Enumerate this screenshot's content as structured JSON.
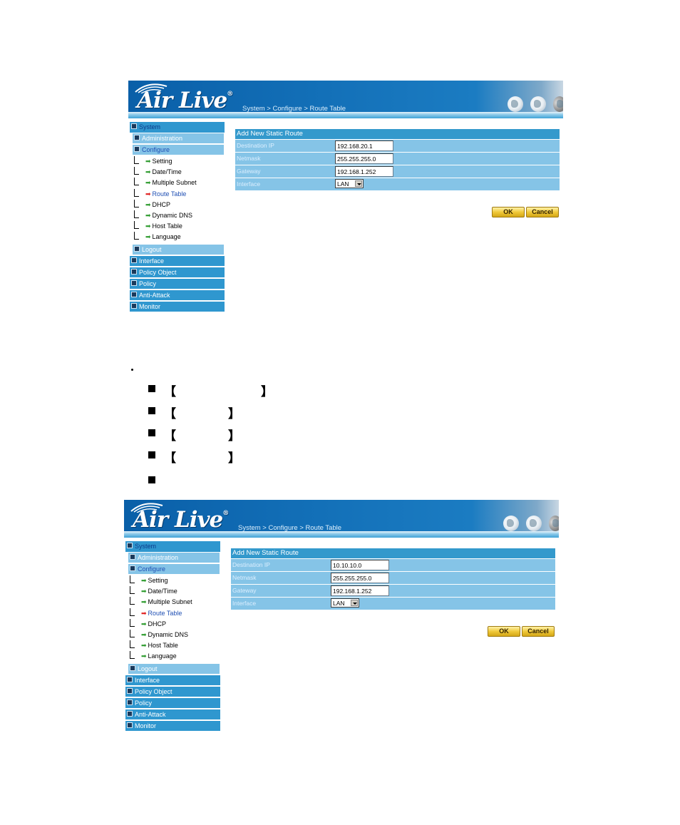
{
  "screenshots": [
    {
      "brand": "Air Live",
      "breadcrumb": "System > Configure > Route Table",
      "sidebar": {
        "system": "System",
        "administration": "Administration",
        "configure": "Configure",
        "items": [
          "Setting",
          "Date/Time",
          "Multiple Subnet",
          "Route Table",
          "DHCP",
          "Dynamic DNS",
          "Host Table",
          "Language"
        ],
        "active_item": "Route Table",
        "logout": "Logout",
        "main": [
          "Interface",
          "Policy Object",
          "Policy",
          "Anti-Attack",
          "Monitor"
        ]
      },
      "form": {
        "title": "Add New Static Route",
        "fields": [
          {
            "label": "Destination IP",
            "value": "192.168.20.1"
          },
          {
            "label": "Netmask",
            "value": "255.255.255.0"
          },
          {
            "label": "Gateway",
            "value": "192.168.1.252"
          }
        ],
        "interface_label": "Interface",
        "interface_value": "LAN"
      },
      "buttons": {
        "ok": "OK",
        "cancel": "Cancel"
      }
    },
    {
      "brand": "Air Live",
      "breadcrumb": "System > Configure > Route Table",
      "sidebar": {
        "system": "System",
        "administration": "Administration",
        "configure": "Configure",
        "items": [
          "Setting",
          "Date/Time",
          "Multiple Subnet",
          "Route Table",
          "DHCP",
          "Dynamic DNS",
          "Host Table",
          "Language"
        ],
        "active_item": "Route Table",
        "logout": "Logout",
        "main": [
          "Interface",
          "Policy Object",
          "Policy",
          "Anti-Attack",
          "Monitor"
        ]
      },
      "form": {
        "title": "Add New Static Route",
        "fields": [
          {
            "label": "Destination IP",
            "value": "10.10.10.0"
          },
          {
            "label": "Netmask",
            "value": "255.255.255.0"
          },
          {
            "label": "Gateway",
            "value": "192.168.1.252"
          }
        ],
        "interface_label": "Interface",
        "interface_value": "LAN"
      },
      "buttons": {
        "ok": "OK",
        "cancel": "Cancel"
      }
    }
  ],
  "doc": {
    "bracket_open": "【",
    "bracket_close": "】"
  }
}
